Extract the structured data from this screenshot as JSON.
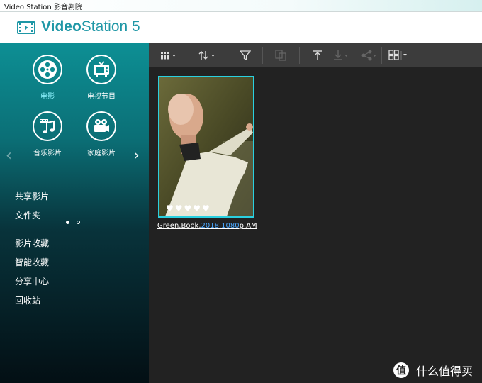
{
  "window": {
    "title": "Video Station 影音剧院"
  },
  "header": {
    "app_name_bold": "Video",
    "app_name_rest": "Station 5"
  },
  "sidebar": {
    "categories": [
      {
        "label": "电影",
        "icon": "film-reel-icon",
        "active": true
      },
      {
        "label": "电视节目",
        "icon": "tv-icon"
      },
      {
        "label": "音乐影片",
        "icon": "music-video-icon"
      },
      {
        "label": "家庭影片",
        "icon": "video-camera-icon"
      }
    ],
    "nav": [
      {
        "label": "共享影片"
      },
      {
        "label": "文件夹"
      },
      {
        "label": "影片收藏"
      },
      {
        "label": "智能收藏"
      },
      {
        "label": "分享中心"
      },
      {
        "label": "回收站"
      }
    ]
  },
  "toolbar": {
    "buttons": [
      "grid-view-icon",
      "sort-icon",
      "filter-icon",
      "copy-icon",
      "upload-icon",
      "download-icon",
      "share-icon",
      "layout-icon"
    ]
  },
  "content": {
    "items": [
      {
        "title_prefix": "Green.Book.",
        "title_highlight": "2018.1080",
        "title_suffix": "p.AM...",
        "rating": "♥♥♥♥♥"
      }
    ]
  },
  "watermark": {
    "logo": "值",
    "text": "什么值得买"
  },
  "colors": {
    "accent": "#1f97a6",
    "selection": "#2ad0e0",
    "highlight_text": "#8ef3ff"
  }
}
